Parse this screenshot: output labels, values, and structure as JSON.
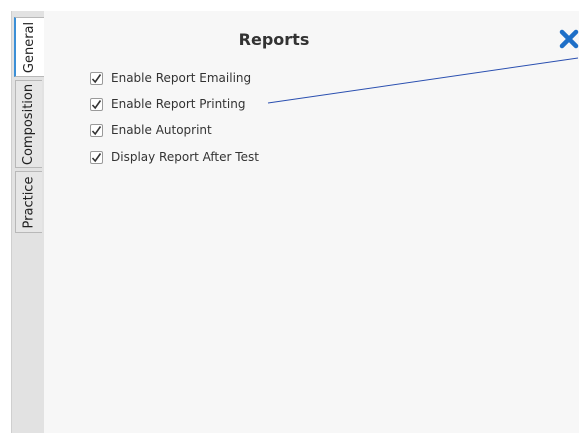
{
  "tabs": [
    {
      "label": "General",
      "active": true
    },
    {
      "label": "Composition",
      "active": false
    },
    {
      "label": "Practice",
      "active": false
    }
  ],
  "panel": {
    "title": "Reports",
    "close_icon": "close-x-icon",
    "accent_color": "#1e6fc7"
  },
  "options": [
    {
      "label": "Enable Report Emailing",
      "checked": true
    },
    {
      "label": "Enable Report Printing",
      "checked": true
    },
    {
      "label": "Enable Autoprint",
      "checked": true
    },
    {
      "label": "Display Report After Test",
      "checked": true
    }
  ],
  "colors": {
    "tab_accent": "#3b8fd6",
    "pointer_line": "#2a4fb0"
  }
}
